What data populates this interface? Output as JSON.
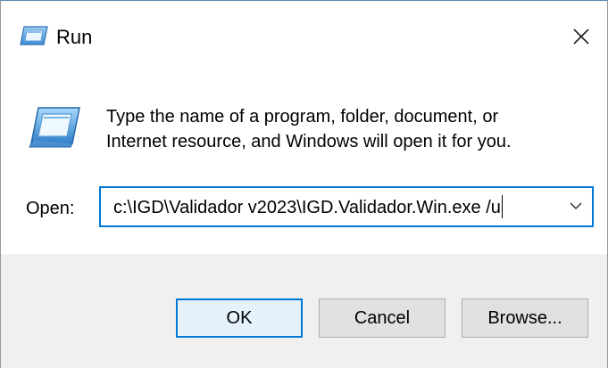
{
  "window": {
    "title": "Run",
    "icon": "run-icon",
    "close_glyph": "✕"
  },
  "main": {
    "description_line1": "Type the name of a program, folder, document, or",
    "description_line2": "Internet resource, and Windows will open it for you.",
    "icon": "run-large-icon"
  },
  "open_field": {
    "label": "Open:",
    "value": "c:\\IGD\\Validador v2023\\IGD.Validador.Win.exe /u",
    "dropdown_glyph": "⌄"
  },
  "buttons": {
    "ok": "OK",
    "cancel": "Cancel",
    "browse": "Browse..."
  },
  "colors": {
    "accent": "#0078d7",
    "footer_bg": "#f0f0f0",
    "button_bg": "#e1e1e1"
  }
}
